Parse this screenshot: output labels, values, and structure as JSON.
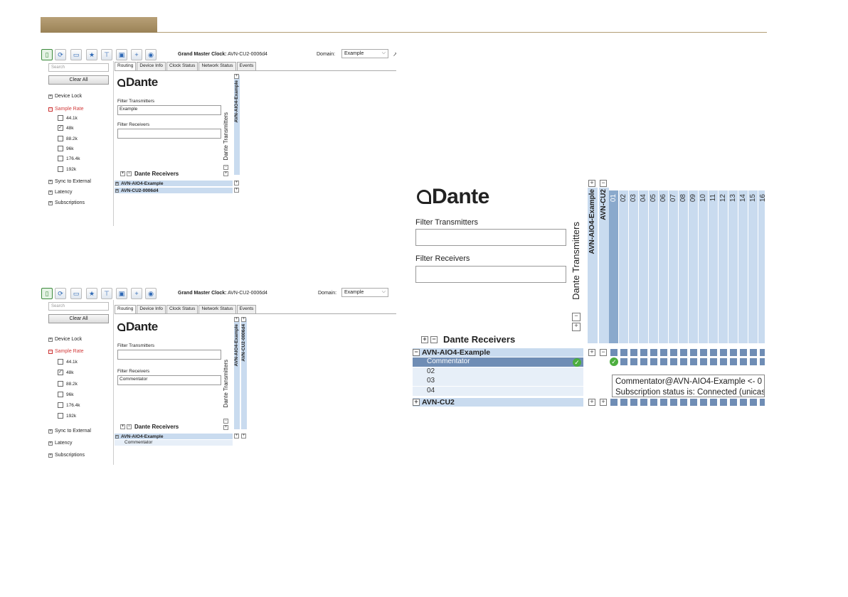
{
  "app": {
    "grand_master_label": "Grand Master Clock:",
    "grand_master_value": "AVN-CU2-0006d4",
    "domain_label": "Domain:",
    "domain_value": "Example",
    "search_placeholder": "Search",
    "clear_all": "Clear All",
    "tabs": [
      "Routing",
      "Device Info",
      "Clock Status",
      "Network Status",
      "Events"
    ],
    "filters": {
      "device_lock": "Device Lock",
      "sample_rate": "Sample Rate",
      "rates": [
        "44.1k",
        "48k",
        "88.2k",
        "96k",
        "176.4k",
        "192k"
      ],
      "rate_checked": "48k",
      "sync_external": "Sync to External",
      "latency": "Latency",
      "subscriptions": "Subscriptions"
    },
    "logo": "Dante",
    "filter_transmitters": "Filter Transmitters",
    "filter_receivers": "Filter Receivers",
    "dante_transmitters": "Dante Transmitters",
    "dante_receivers": "Dante Receivers"
  },
  "shot1": {
    "tx_filter_value": "Example",
    "rx_filter_value": "",
    "tx_columns": [
      "AVN-AIO4-Example"
    ],
    "rx_rows": [
      "AVN-AIO4-Example",
      "AVN-CU2-0006d4"
    ]
  },
  "shot2": {
    "tx_filter_value": "",
    "rx_filter_value": "Commentator",
    "tx_columns": [
      "AVN-AIO4-Example",
      "AVN-CU2-0006d4"
    ],
    "rx_rows": [
      "AVN-AIO4-Example"
    ],
    "rx_sub": "Commentator"
  },
  "zoom": {
    "tx_columns": [
      "AVN-AIO4-Example",
      "AVN-CU2"
    ],
    "channels": [
      "01",
      "02",
      "03",
      "04",
      "05",
      "06",
      "07",
      "08",
      "09",
      "10",
      "11",
      "12",
      "13",
      "14",
      "15",
      "16"
    ],
    "rx_device": "AVN-AIO4-Example",
    "rx_channels": [
      "Commentator",
      "02",
      "03",
      "04"
    ],
    "rx_device2": "AVN-CU2",
    "tooltip_line1": "Commentator@AVN-AIO4-Example <- 0",
    "tooltip_line2": "Subscription status is: Connected (unicas"
  }
}
